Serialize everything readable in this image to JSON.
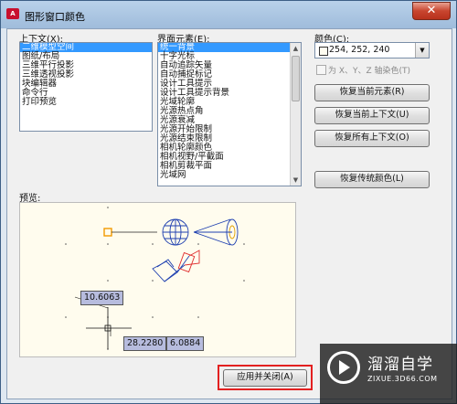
{
  "window": {
    "title": "图形窗口颜色",
    "app_icon_text": "A",
    "close_symbol": "✕"
  },
  "context": {
    "label": "上下文(X):",
    "items": [
      "二维模型空间",
      "图纸/布局",
      "三维平行投影",
      "三维透视投影",
      "块编辑器",
      "命令行",
      "打印预览"
    ],
    "selected_index": 0
  },
  "interface": {
    "label": "界面元素(E):",
    "items": [
      "统一背景",
      "十字光标",
      "自动追踪矢量",
      "自动捕捉标记",
      "设计工具提示",
      "设计工具提示背景",
      "光域轮廓",
      "光源热点角",
      "光源衰减",
      "光源开始限制",
      "光源结束限制",
      "相机轮廓颜色",
      "相机视野/平截面",
      "相机剪裁平面",
      "光域网"
    ],
    "selected_index": 0
  },
  "color": {
    "label": "颜色(C):",
    "value": "254, 252, 240",
    "swatch": "#fefcf0",
    "tint_checkbox_label": "为 X、Y、Z 轴染色(T)"
  },
  "buttons": {
    "restore_element": "恢复当前元素(R)",
    "restore_context": "恢复当前上下文(U)",
    "restore_all": "恢复所有上下文(O)",
    "restore_classic": "恢复传统颜色(L)",
    "apply_close": "应用并关闭(A)"
  },
  "preview": {
    "label": "预览:",
    "coord_1": "10.6063",
    "coord_2": "28.2280",
    "coord_3": "6.0884"
  },
  "watermark": {
    "cn": "溜溜自学",
    "en": "ZIXUE.3D66.COM"
  },
  "colors": {
    "accent": "#3399ff",
    "highlight": "#e32020",
    "preview_bg": "#fffcee"
  }
}
